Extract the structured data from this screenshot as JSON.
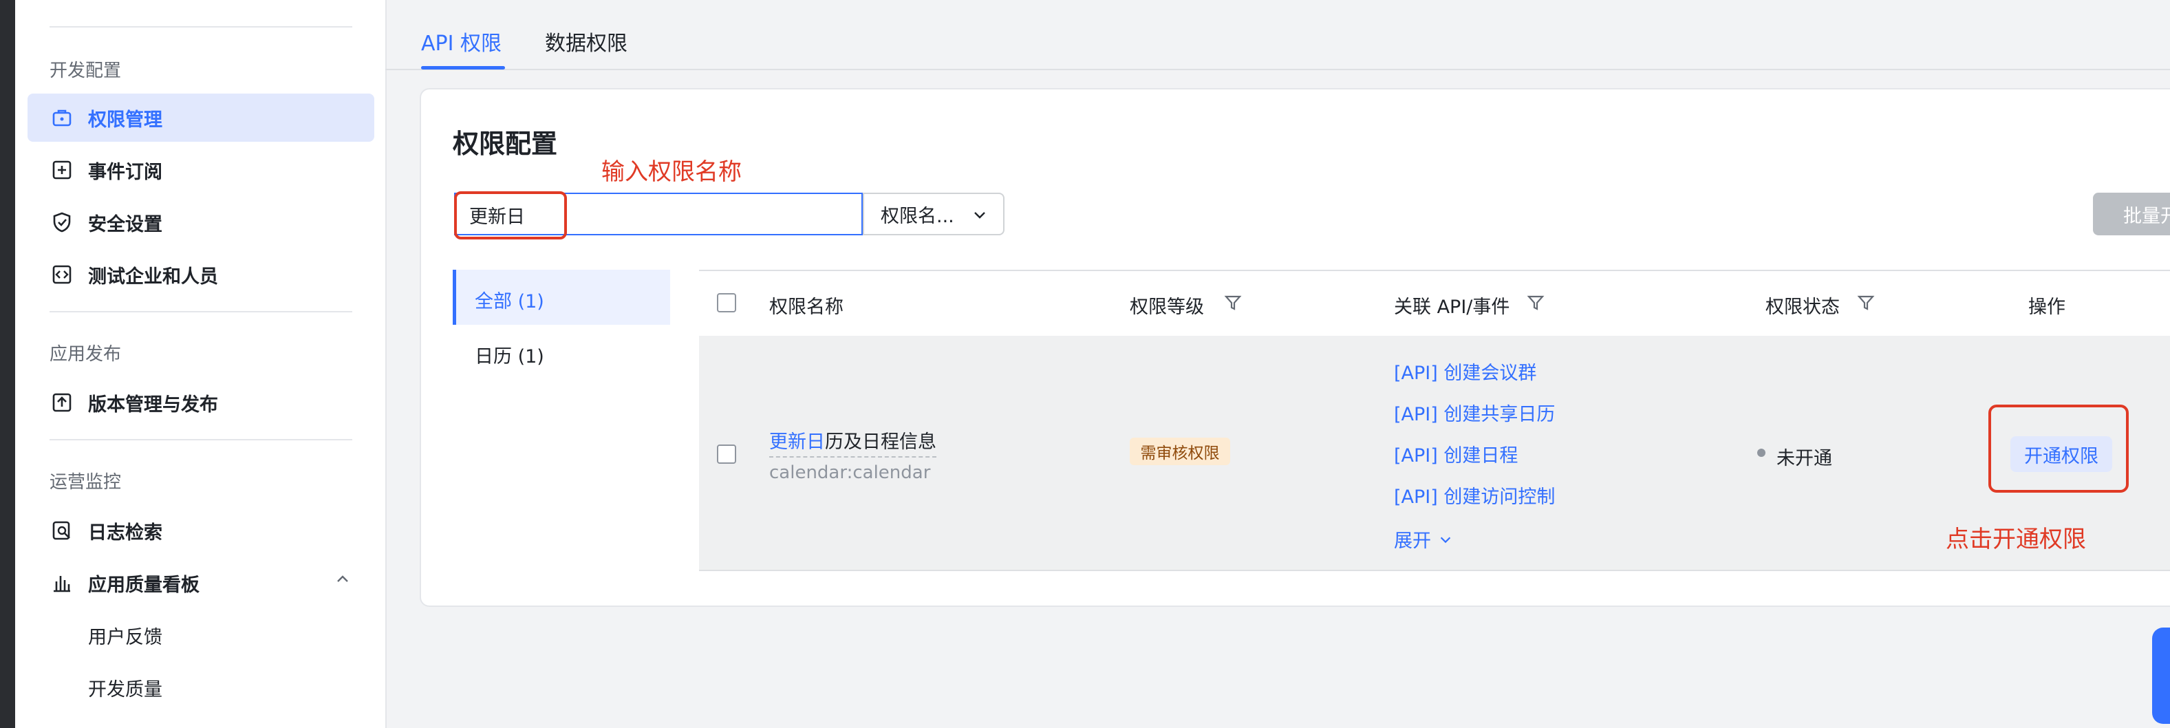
{
  "sidebar": {
    "groups": [
      {
        "title": "开发配置"
      },
      {
        "title": "应用发布"
      },
      {
        "title": "运营监控"
      }
    ],
    "items": [
      {
        "label": "权限管理",
        "icon": "permission-briefcase-icon",
        "active": true
      },
      {
        "label": "事件订阅",
        "icon": "event-plus-icon"
      },
      {
        "label": "安全设置",
        "icon": "shield-icon"
      },
      {
        "label": "测试企业和人员",
        "icon": "code-icon"
      },
      {
        "label": "版本管理与发布",
        "icon": "upload-icon"
      },
      {
        "label": "日志检索",
        "icon": "log-search-icon"
      },
      {
        "label": "应用质量看板",
        "icon": "bar-chart-icon"
      }
    ],
    "subitems": [
      {
        "label": "用户反馈"
      },
      {
        "label": "开发质量"
      }
    ]
  },
  "tabs": [
    {
      "label": "API 权限",
      "active": true
    },
    {
      "label": "数据权限"
    }
  ],
  "card": {
    "title": "权限配置",
    "search_value": "更新日",
    "select_label": "权限名...",
    "batch_button": "批量开",
    "annotation_input": "输入权限名称",
    "annotation_click": "点击开通权限"
  },
  "categories": [
    {
      "label": "全部 (1)",
      "active": true
    },
    {
      "label": "日历 (1)"
    }
  ],
  "table": {
    "headers": {
      "name": "权限名称",
      "level": "权限等级",
      "api": "关联 API/事件",
      "status": "权限状态",
      "action": "操作"
    },
    "rows": [
      {
        "name_highlight": "更新日",
        "name_rest": "历及日程信息",
        "scope": "calendar:calendar",
        "level": "需审核权限",
        "apis": [
          "[API] 创建会议群",
          "[API] 创建共享日历",
          "[API] 创建日程",
          "[API] 创建访问控制"
        ],
        "expand": "展开",
        "status": "未开通",
        "action": "开通权限"
      }
    ]
  },
  "colors": {
    "accent": "#3370ff",
    "annotation": "#e03a25",
    "badge_bg": "#fdebd3"
  }
}
